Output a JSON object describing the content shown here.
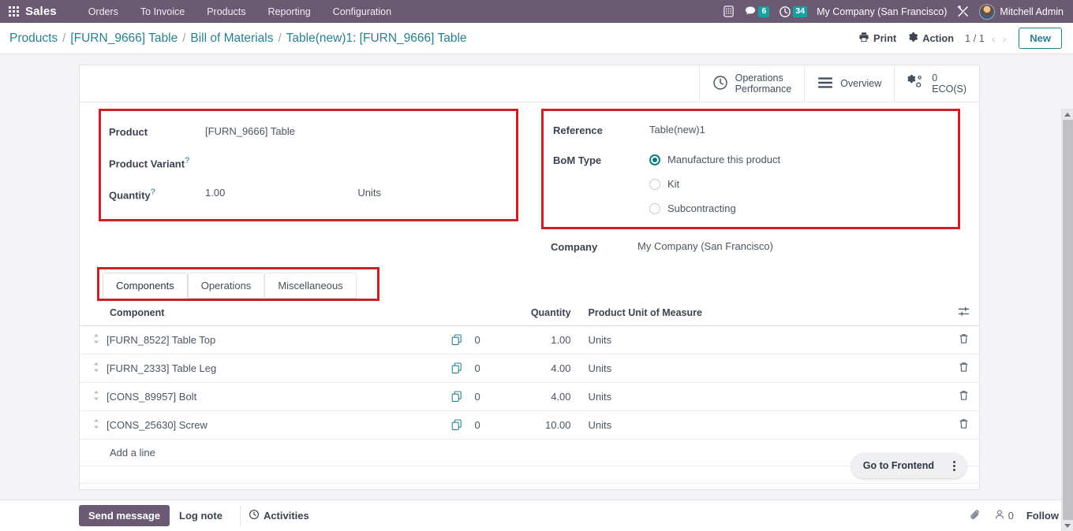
{
  "navbar": {
    "apps_icon": "apps-grid-icon",
    "brand": "Sales",
    "menus": [
      "Orders",
      "To Invoice",
      "Products",
      "Reporting",
      "Configuration"
    ],
    "phone_icon": "phone-keypad-icon",
    "messages": {
      "icon": "chat-bubble-icon",
      "count": "6"
    },
    "activities": {
      "icon": "clock-icon",
      "count": "34"
    },
    "company": "My Company (San Francisco)",
    "debug_icon": "wrench-screwdriver-icon",
    "user": "Mitchell Admin",
    "bg_color": "#6b5a74",
    "badge_color": "#17a2a2"
  },
  "controlpanel": {
    "breadcrumb": [
      {
        "label": "Products",
        "link": true
      },
      {
        "label": "[FURN_9666] Table",
        "link": true
      },
      {
        "label": "Bill of Materials",
        "link": true
      },
      {
        "label": "Table(new)1: [FURN_9666] Table",
        "link": false
      }
    ],
    "separator": "/",
    "print_label": "Print",
    "print_icon": "printer-icon",
    "action_label": "Action",
    "action_icon": "gear-icon",
    "pager": "1 / 1",
    "prev_icon": "chevron-left-icon",
    "next_icon": "chevron-right-icon",
    "new_label": "New",
    "accent_color": "#2a7f8f"
  },
  "statbuttons": [
    {
      "icon": "clock-icon",
      "line1": "Operations",
      "line2": "Performance"
    },
    {
      "icon": "list-icon",
      "line1": "Overview",
      "line2": ""
    },
    {
      "icon": "gears-icon",
      "line1": "0",
      "line2": "ECO(S)"
    }
  ],
  "form": {
    "left": {
      "highlighted": true,
      "fields": [
        {
          "label": "Product",
          "help": false,
          "value": "[FURN_9666] Table",
          "uom": ""
        },
        {
          "label": "Product Variant",
          "help": true,
          "value": "",
          "uom": ""
        },
        {
          "label": "Quantity",
          "help": true,
          "value": "1.00",
          "uom": "Units"
        }
      ]
    },
    "right": {
      "highlighted": true,
      "reference_label": "Reference",
      "reference_value": "Table(new)1",
      "bom_type_label": "BoM Type",
      "bom_type_options": [
        {
          "label": "Manufacture this product",
          "selected": true
        },
        {
          "label": "Kit",
          "selected": false
        },
        {
          "label": "Subcontracting",
          "selected": false
        }
      ],
      "company_label": "Company",
      "company_value": "My Company (San Francisco)",
      "radio_color": "#107a7a"
    }
  },
  "notebook": {
    "highlighted": true,
    "tabs": [
      {
        "label": "Components",
        "active": true
      },
      {
        "label": "Operations",
        "active": false
      },
      {
        "label": "Miscellaneous",
        "active": false
      }
    ]
  },
  "table": {
    "columns": {
      "component": "Component",
      "quantity": "Quantity",
      "uom": "Product Unit of Measure"
    },
    "optional_columns_icon": "sliders-icon",
    "drag_icon": "drag-handle-icon",
    "copy_icon": "copy-documents-icon",
    "delete_icon": "trash-icon",
    "rows": [
      {
        "component": "[FURN_8522] Table Top",
        "attachments": "0",
        "quantity": "1.00",
        "uom": "Units"
      },
      {
        "component": "[FURN_2333] Table Leg",
        "attachments": "0",
        "quantity": "4.00",
        "uom": "Units"
      },
      {
        "component": "[CONS_89957] Bolt",
        "attachments": "0",
        "quantity": "4.00",
        "uom": "Units"
      },
      {
        "component": "[CONS_25630] Screw",
        "attachments": "0",
        "quantity": "10.00",
        "uom": "Units"
      }
    ],
    "add_line": "Add a line"
  },
  "frontend_pill": {
    "label": "Go to Frontend",
    "menu_icon": "vertical-dots-icon"
  },
  "chatter": {
    "send_message": "Send message",
    "log_note": "Log note",
    "activities": "Activities",
    "activities_icon": "clock-icon",
    "attachment_icon": "paperclip-icon",
    "followers_icon": "person-icon",
    "followers_count": "0",
    "follow": "Follow"
  },
  "highlight_color": "#cc2026"
}
